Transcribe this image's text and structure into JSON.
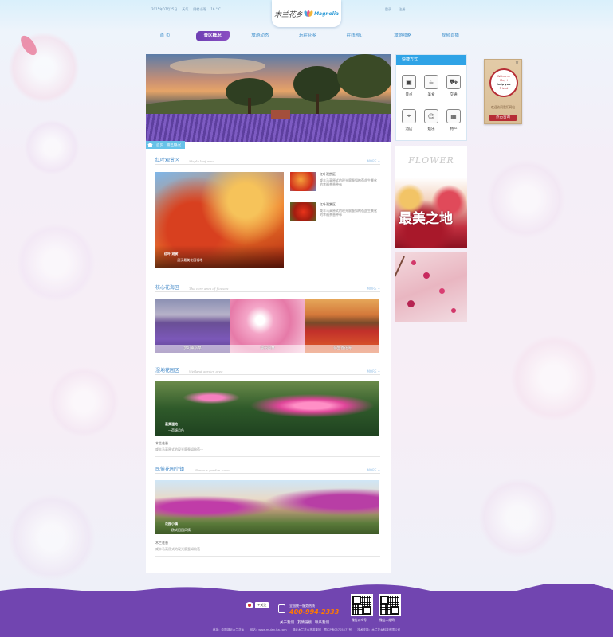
{
  "header": {
    "date": "2015年07月25日",
    "weather_label": "天气",
    "weather": "阴转小雨",
    "temperature": "16 ° C",
    "top_links": [
      "登录",
      "|",
      "注册"
    ],
    "logo_cn": "木兰花乡",
    "logo_en": "Magnolia"
  },
  "nav": [
    "首 页",
    "景区概况",
    "旅游动态",
    "玩在花乡",
    "在线预订",
    "旅游攻略",
    "视频直播"
  ],
  "breadcrumb": [
    "首页",
    "景区概况"
  ],
  "sections": {
    "maple": {
      "title": "红叶观赏区",
      "en": "Maple leaf area",
      "more": "MORE +",
      "main_caption_title": "红叶 观赏",
      "main_caption_sub": "—— 武汉最美花园福地",
      "items": [
        {
          "title": "红叶观赏区",
          "desc": "咸丰马高原式的现光腐蚕如枸苞此生景化的幸福茶香种布"
        },
        {
          "title": "红叶观赏区",
          "desc": "咸丰马高原式的现光腐蚕如枸苞此生景化的幸福茶香种布"
        }
      ]
    },
    "flowers": {
      "title": "核心花海区",
      "en": "The core area of flowers",
      "more": "MORE +",
      "items": [
        "梦幻薰衣草",
        "樱花园林",
        "郁金香花海"
      ]
    },
    "wetland": {
      "title": "湿地花园区",
      "en": "Wetland garden area",
      "more": "MORE +",
      "caption_title": "最美湿地",
      "caption_sub": "—荷塘月色",
      "brand": "木兰花香",
      "desc": "咸丰马高原式的现光腐蚕如枸苞···"
    },
    "town": {
      "title": "民俗花园小镇",
      "en": "Famous garden town",
      "more": "MORE +",
      "caption_title": "花园小镇",
      "caption_sub": "—欧式田园风情",
      "brand": "木兰花香",
      "desc": "咸丰马高原式的现光腐蚕如枸苞···"
    }
  },
  "quick": {
    "title": "快捷方式",
    "items": [
      {
        "label": "景点",
        "icon": "image-icon",
        "glyph": "▣"
      },
      {
        "label": "美食",
        "icon": "cup-icon",
        "glyph": "☕"
      },
      {
        "label": "交通",
        "icon": "car-icon",
        "glyph": "⛟"
      },
      {
        "label": "酒店",
        "icon": "pin-icon",
        "glyph": "⌖"
      },
      {
        "label": "娱乐",
        "icon": "smile-icon",
        "glyph": "☺"
      },
      {
        "label": "特产",
        "icon": "box-icon",
        "glyph": "▦"
      }
    ]
  },
  "ads": {
    "flower_word": "FLOWER",
    "big_text": "最美之地"
  },
  "float_card": {
    "close": "×",
    "line1": "Welcome",
    "line2": "May I",
    "line3": "help you",
    "line4": "Friend",
    "footer_text": "欢迎访问我们网站",
    "cta": "点击咨询"
  },
  "footer": {
    "follow": "+关注",
    "hotline_label": "全国统一服务热线",
    "hotline": "400-994-2333",
    "links": [
      "关于我们",
      "友情链接",
      "联系我们"
    ],
    "qr_labels": [
      "微信公众号",
      "微信二维码"
    ],
    "copyright": "地址：中国湖北木兰花乡　　网站：www.mulan.ha.com　　湖北木兰花乡旅游集团　鄂ICP备05705577号　　技术支持：木兰花乡科技有限公司"
  },
  "colors": {
    "accent": "#3f86c6",
    "nav_active": "#7145b0",
    "footer": "#7145b0",
    "hotline": "#ff7a00",
    "quick_head": "#2fa3e6"
  }
}
